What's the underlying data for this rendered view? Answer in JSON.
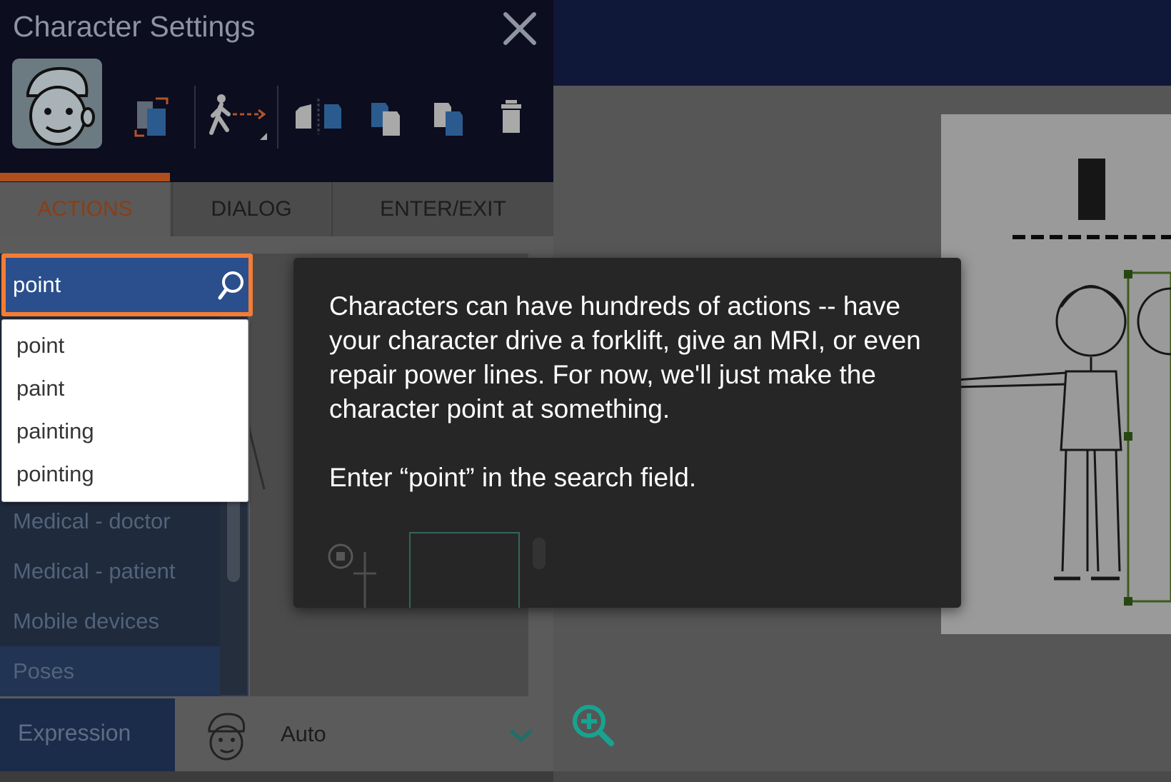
{
  "panel": {
    "title": "Character Settings",
    "tools": [
      {
        "icon": "swap-pages-icon"
      },
      {
        "icon": "walk-motion-icon"
      },
      {
        "icon": "split-pages-icon"
      },
      {
        "icon": "copy-page-icon"
      },
      {
        "icon": "paste-page-icon"
      },
      {
        "icon": "trash-icon"
      }
    ],
    "tabs": {
      "actions": "ACTIONS",
      "dialog": "DIALOG",
      "enter_exit": "ENTER/EXIT"
    }
  },
  "search": {
    "value": "point",
    "suggestions": [
      "point",
      "paint",
      "painting",
      "pointing"
    ]
  },
  "categories": [
    "Medical - doctor",
    "Medical - patient",
    "Mobile devices",
    "Poses"
  ],
  "expression": {
    "label": "Expression",
    "value": "Auto"
  },
  "tooltip": {
    "paragraph1": "Characters can have hundreds of actions -- have your character drive a forklift, give an MRI, or even repair power lines. For now, we'll just make the character point at something.",
    "paragraph2": "Enter “point” in the search field."
  },
  "colors": {
    "accent": "#f47c34",
    "active_tab": "#b04f1d",
    "header": "#0c0d1f",
    "search_bg": "#2a4f8c",
    "zoom": "#17a38f"
  }
}
